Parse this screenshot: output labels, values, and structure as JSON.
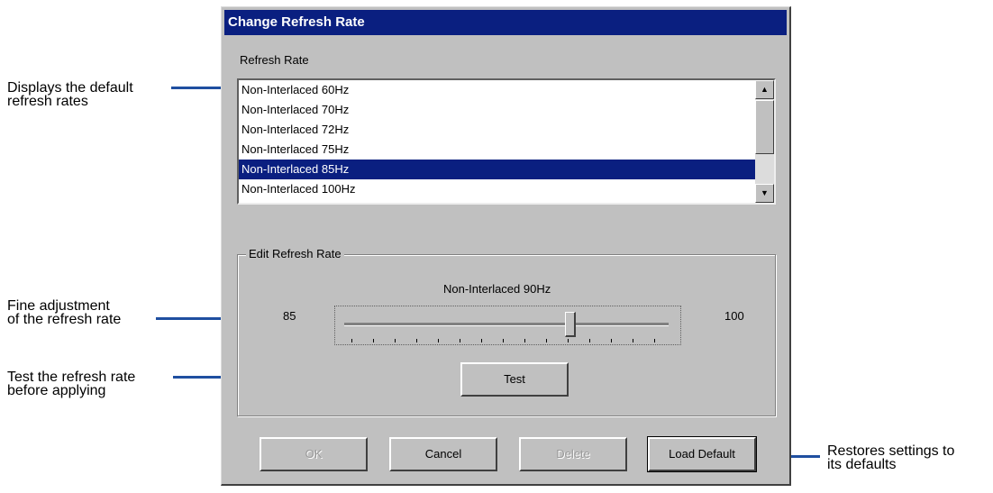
{
  "dialog": {
    "title": "Change Refresh Rate",
    "list_label": "Refresh Rate",
    "refresh_rates": [
      "Non-Interlaced 60Hz",
      "Non-Interlaced 70Hz",
      "Non-Interlaced 72Hz",
      "Non-Interlaced 75Hz",
      "Non-Interlaced 85Hz",
      "Non-Interlaced 100Hz"
    ],
    "selected_index": 4,
    "edit_group_label": "Edit Refresh Rate",
    "slider": {
      "current_label": "Non-Interlaced 90Hz",
      "min": "85",
      "max": "100",
      "value": 90
    },
    "test_label": "Test",
    "buttons": {
      "ok": "OK",
      "cancel": "Cancel",
      "delete": "Delete",
      "load_default": "Load Default"
    }
  },
  "annotations": {
    "list": "Displays the default\nrefresh rates",
    "slider": "Fine adjustment\nof the refresh rate",
    "test": "Test the refresh rate\nbefore applying",
    "load_default": "Restores settings to\nits defaults"
  },
  "colors": {
    "title_bar": "#0a1f80",
    "selection": "#0a1f80",
    "callout_line": "#1f4fa0",
    "dialog_face": "#c0c0c0"
  }
}
